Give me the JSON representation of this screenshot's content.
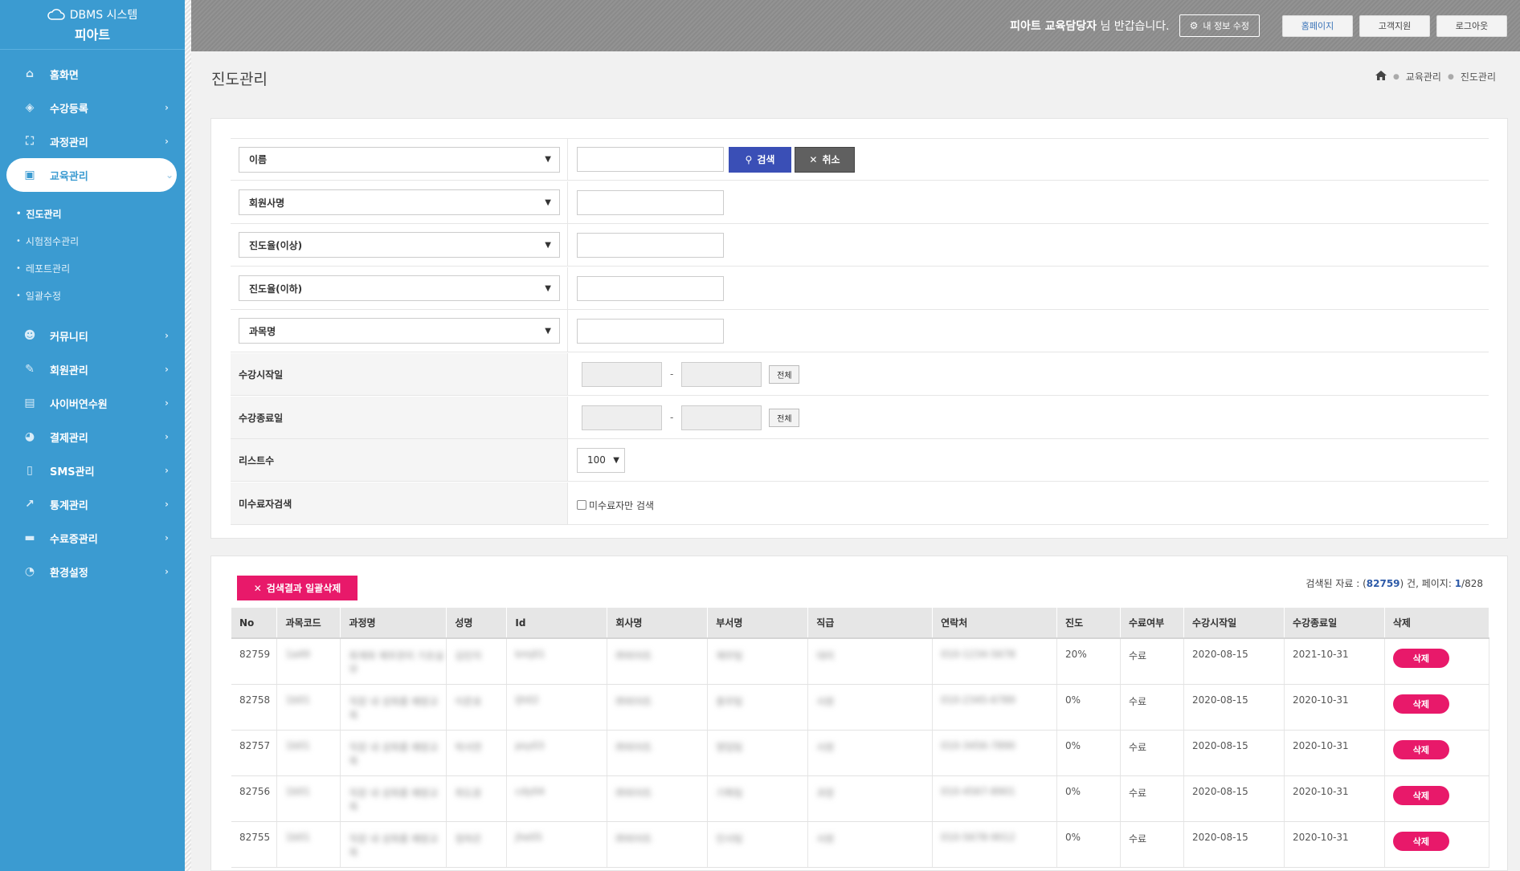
{
  "brand": {
    "line1": "DBMS 시스템",
    "line2": "피아트"
  },
  "sidebar": {
    "items": [
      {
        "label": "홈화면",
        "icon": "home-icon",
        "glyph": "⌂",
        "chevron": ""
      },
      {
        "label": "수강등록",
        "icon": "layers-icon",
        "glyph": "◈",
        "chevron": "›"
      },
      {
        "label": "과정관리",
        "icon": "sitemap-icon",
        "glyph": "⛶",
        "chevron": "›"
      },
      {
        "label": "교육관리",
        "icon": "graduate-icon",
        "glyph": "▣",
        "chevron": "⌄"
      },
      {
        "label": "커뮤니티",
        "icon": "users-icon",
        "glyph": "☻",
        "chevron": "›"
      },
      {
        "label": "회원관리",
        "icon": "pencil-icon",
        "glyph": "✎",
        "chevron": "›"
      },
      {
        "label": "사이버연수원",
        "icon": "id-card-icon",
        "glyph": "▤",
        "chevron": "›"
      },
      {
        "label": "결제관리",
        "icon": "user-icon",
        "glyph": "◕",
        "chevron": "›"
      },
      {
        "label": "SMS관리",
        "icon": "mobile-icon",
        "glyph": "▯",
        "chevron": "›"
      },
      {
        "label": "통계관리",
        "icon": "chart-icon",
        "glyph": "↗",
        "chevron": "›"
      },
      {
        "label": "수료증관리",
        "icon": "card-icon",
        "glyph": "▬",
        "chevron": "›"
      },
      {
        "label": "환경설정",
        "icon": "pie-icon",
        "glyph": "◔",
        "chevron": "›"
      }
    ],
    "submenu": [
      "진도관리",
      "시험점수관리",
      "레포트관리",
      "일괄수정"
    ]
  },
  "header": {
    "user_name": "피아트 교육담당자",
    "greeting": " 님 반갑습니다.",
    "edit_info": "내 정보 수정",
    "homepage": "홈페이지",
    "support": "고객지원",
    "logout": "로그아웃"
  },
  "page": {
    "title": "진도관리",
    "breadcrumb": [
      "교육관리",
      "진도관리"
    ]
  },
  "search": {
    "select1": "이름",
    "select2": "회원사명",
    "select3": "진도율(이상)",
    "select4": "진도율(이하)",
    "select5": "과목명",
    "search_btn": "검색",
    "cancel_btn": "취소",
    "start_label": "수강시작일",
    "end_label": "수강종료일",
    "all_btn": "전체",
    "dash": "-",
    "list_label": "리스트수",
    "list_value": "100",
    "incomplete_label": "미수료자검색",
    "incomplete_checkbox": "미수료자만 검색"
  },
  "list": {
    "bulk_delete": "검색결과 일괄삭제",
    "info_prefix": "검색된 자료 : (",
    "total": "82759",
    "info_mid": ") 건, 페이지: ",
    "page": "1",
    "info_suffix": "/828",
    "columns": [
      "No",
      "과목코드",
      "과정명",
      "성명",
      "Id",
      "회사명",
      "부서명",
      "직급",
      "연락처",
      "진도",
      "수료여부",
      "수강시작일",
      "수강종료일",
      "삭제"
    ],
    "delete_label": "삭제",
    "rows": [
      {
        "no": "82759",
        "code": "1a49",
        "course": "회계와 재무관리 기초실무",
        "name": "김민지",
        "id": "kmj01",
        "company": "㈜피아트",
        "dept": "재무팀",
        "rank": "대리",
        "phone": "010-1234-5678",
        "progress": "20%",
        "done": "수료",
        "start": "2020-08-15",
        "end": "2021-10-31"
      },
      {
        "no": "82758",
        "code": "1b01",
        "course": "직장 내 성희롱 예방교육",
        "name": "이준호",
        "id": "ljh02",
        "company": "㈜피아트",
        "dept": "총무팀",
        "rank": "사원",
        "phone": "010-2345-6789",
        "progress": "0%",
        "done": "수료",
        "start": "2020-08-15",
        "end": "2020-10-31"
      },
      {
        "no": "82757",
        "code": "1b01",
        "course": "직장 내 성희롱 예방교육",
        "name": "박서연",
        "id": "psy03",
        "company": "㈜피아트",
        "dept": "영업팀",
        "rank": "사원",
        "phone": "010-3456-7890",
        "progress": "0%",
        "done": "수료",
        "start": "2020-08-15",
        "end": "2020-10-31"
      },
      {
        "no": "82756",
        "code": "1b01",
        "course": "직장 내 성희롱 예방교육",
        "name": "최도윤",
        "id": "cdy04",
        "company": "㈜피아트",
        "dept": "기획팀",
        "rank": "과장",
        "phone": "010-4567-8901",
        "progress": "0%",
        "done": "수료",
        "start": "2020-08-15",
        "end": "2020-10-31"
      },
      {
        "no": "82755",
        "code": "1b01",
        "course": "직장 내 성희롱 예방교육",
        "name": "정하은",
        "id": "jhe05",
        "company": "㈜피아트",
        "dept": "인사팀",
        "rank": "사원",
        "phone": "010-5678-9012",
        "progress": "0%",
        "done": "수료",
        "start": "2020-08-15",
        "end": "2020-10-31"
      }
    ]
  },
  "colors": {
    "sidebar": "#3b9bd1",
    "accent_pink": "#e8196a",
    "search_blue": "#3a4fb6"
  }
}
